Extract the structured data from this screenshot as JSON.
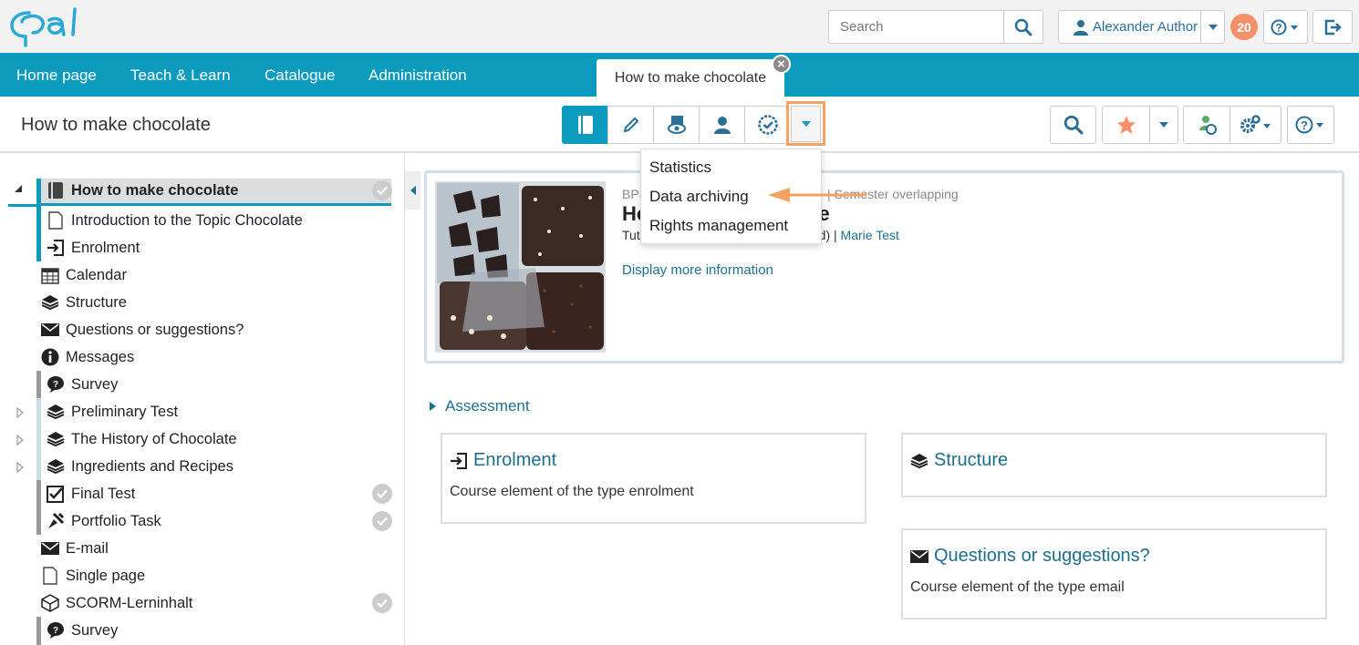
{
  "app": {
    "logo_text": "opal"
  },
  "header": {
    "search_placeholder": "Search",
    "user_name": "Alexander Author",
    "notification_count": "20"
  },
  "nav": {
    "items": [
      "Home page",
      "Teach & Learn",
      "Catalogue",
      "Administration"
    ],
    "active_tab": "How to make chocolate"
  },
  "toolbar": {
    "course_title": "How to make chocolate"
  },
  "dropdown": {
    "items": [
      "Statistics",
      "Data archiving",
      "Rights management"
    ]
  },
  "sidebar": {
    "items": [
      {
        "label": "How to make chocolate",
        "icon": "book-icon"
      },
      {
        "label": "Introduction to the Topic Chocolate",
        "icon": "page-icon"
      },
      {
        "label": "Enrolment",
        "icon": "enrolment-icon"
      },
      {
        "label": "Calendar",
        "icon": "calendar-icon"
      },
      {
        "label": "Structure",
        "icon": "layers-icon"
      },
      {
        "label": "Questions or suggestions?",
        "icon": "envelope-icon"
      },
      {
        "label": "Messages",
        "icon": "info-icon"
      },
      {
        "label": "Survey",
        "icon": "survey-icon"
      },
      {
        "label": "Preliminary Test",
        "icon": "layers-icon"
      },
      {
        "label": "The History of Chocolate",
        "icon": "layers-icon"
      },
      {
        "label": "Ingredients and Recipes",
        "icon": "layers-icon"
      },
      {
        "label": "Final Test",
        "icon": "checkbox-icon"
      },
      {
        "label": "Portfolio Task",
        "icon": "portfolio-icon"
      },
      {
        "label": "E-mail",
        "icon": "envelope-icon"
      },
      {
        "label": "Single page",
        "icon": "page-icon"
      },
      {
        "label": "SCORM-Lerninhalt",
        "icon": "scorm-icon"
      },
      {
        "label": "Survey",
        "icon": "survey-icon"
      }
    ]
  },
  "course_info": {
    "meta_line": "BPS",
    "meta_line_right": "| Semester overlapping",
    "title_start": "Ho",
    "title_end": "ate",
    "type_prefix": "Tut",
    "type_suffix": "ted)",
    "author": "Marie Test",
    "more_info": "Display more information"
  },
  "main": {
    "assessment": "Assessment",
    "cards": [
      {
        "title": "Enrolment",
        "desc": "Course element of the type enrolment"
      },
      {
        "title": "Structure",
        "desc": ""
      },
      {
        "title": "Questions or suggestions?",
        "desc": "Course element of the type email"
      }
    ]
  },
  "colors": {
    "accent": "#0c9bbd",
    "highlight": "#f4a261",
    "link": "#1e6f8d",
    "badge": "#f4916b"
  }
}
